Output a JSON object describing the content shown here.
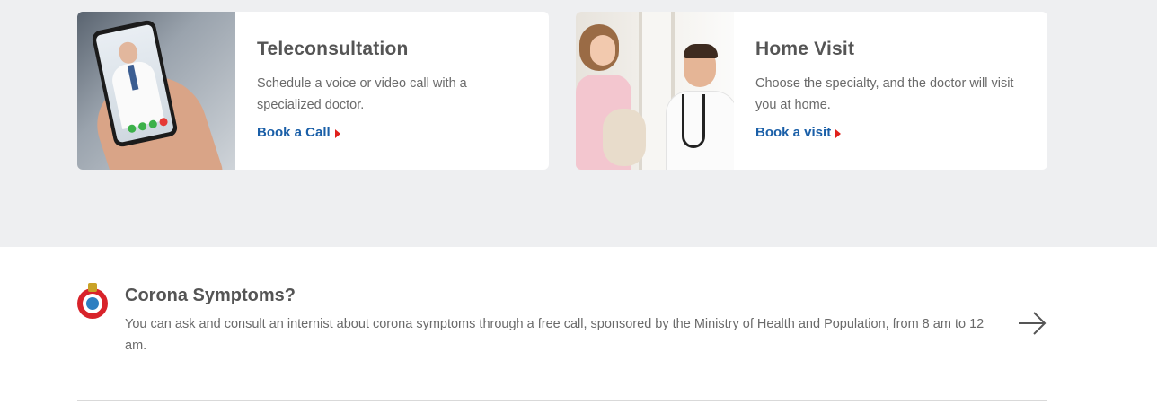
{
  "services": [
    {
      "title": "Teleconsultation",
      "description": "Schedule a voice or video call with a specialized doctor.",
      "link_label": "Book a Call",
      "image_icon": "doctor-video-call-phone"
    },
    {
      "title": "Home Visit",
      "description": "Choose the specialty, and the doctor will visit you at home.",
      "link_label": "Book a visit",
      "image_icon": "doctor-home-visit"
    }
  ],
  "corona": {
    "title": "Corona Symptoms?",
    "description": "You can ask and consult an internist about corona symptoms through a free call, sponsored by the Ministry of Health and Population, from 8 am to 12 am.",
    "logo_icon": "ministry-of-health-logo",
    "arrow_icon": "arrow-right-icon"
  },
  "colors": {
    "band_background": "#eeeff1",
    "link": "#1a5fa8",
    "link_arrow": "#e0201b",
    "title": "#555555",
    "text": "#6a6a6a"
  }
}
